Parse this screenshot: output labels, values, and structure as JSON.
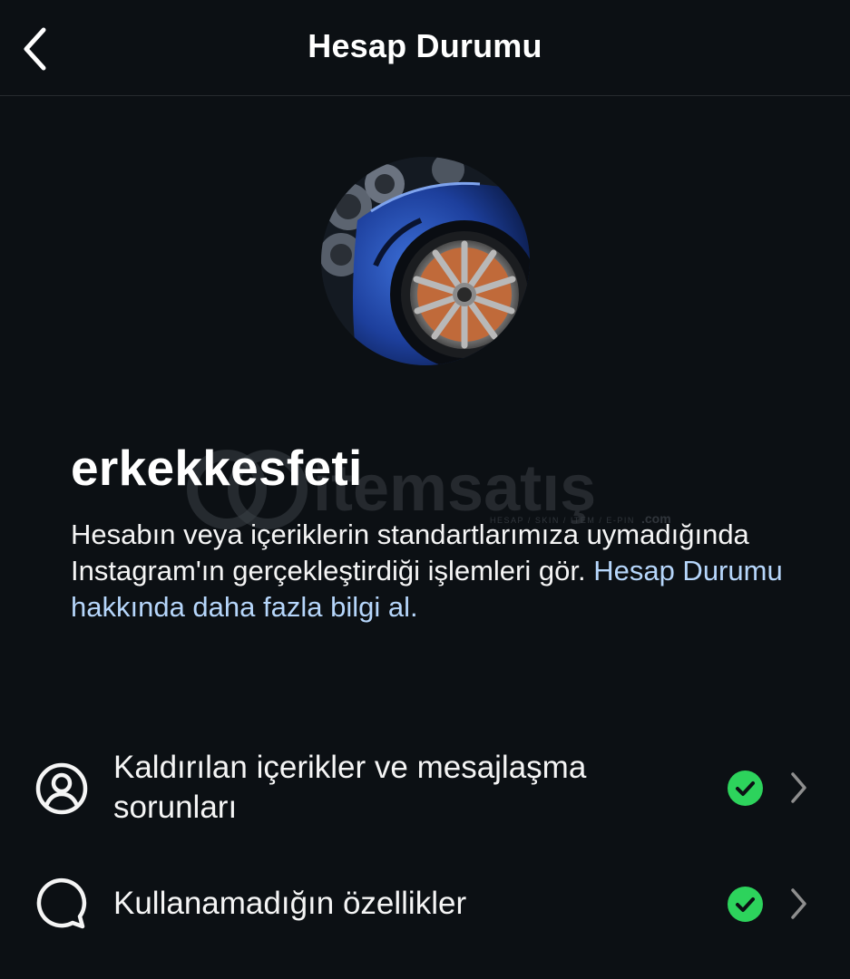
{
  "header": {
    "title": "Hesap Durumu",
    "back_icon": "chevron-left-icon"
  },
  "profile": {
    "username": "erkekkesfeti",
    "avatar_description_icon": "profile-photo",
    "description_text": "Hesabın veya içeriklerin standartlarımıza uymadığında Instagram'ın gerçekleştirdiği işlemleri gör. ",
    "description_link": "Hesap Durumu hakkında daha fazla bilgi al."
  },
  "watermark": {
    "brand": "itemsatış",
    "tagline": "HESAP / SKIN / ITEM / E-PIN",
    "suffix": ".com"
  },
  "items": [
    {
      "label": "Kaldırılan içerikler ve mesajlaşma sorunları",
      "icon": "user-circle-icon",
      "status": "ok"
    },
    {
      "label": "Kullanamadığın özellikler",
      "icon": "chat-bubble-icon",
      "status": "ok"
    }
  ],
  "colors": {
    "background": "#0c1014",
    "text": "#f5f5f5",
    "link": "#b6d6fb",
    "success": "#2dd35c",
    "chevron": "#8e8e8e"
  }
}
